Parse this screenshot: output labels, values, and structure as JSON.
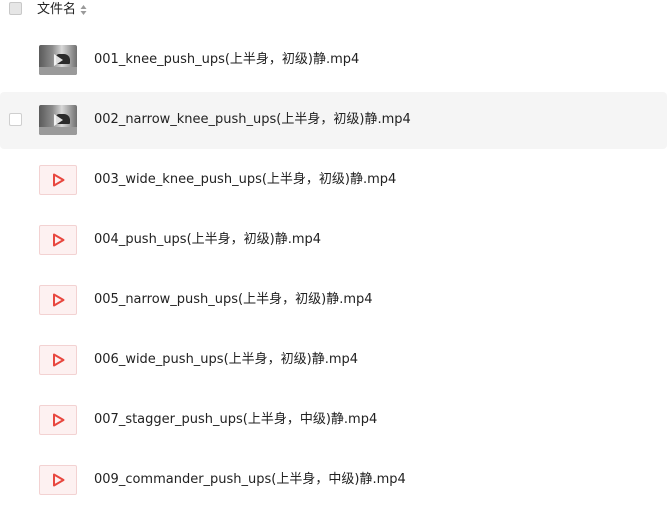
{
  "header": {
    "column_label": "文件名",
    "sort_icon": "sort-icon"
  },
  "files": [
    {
      "name": "001_knee_push_ups(上半身，初级)静.mp4",
      "thumb": "video-thumbnail"
    },
    {
      "name": "002_narrow_knee_push_ups(上半身，初级)静.mp4",
      "thumb": "video-thumbnail"
    },
    {
      "name": "003_wide_knee_push_ups(上半身，初级)静.mp4",
      "thumb": "video-file-icon"
    },
    {
      "name": "004_push_ups(上半身，初级)静.mp4",
      "thumb": "video-file-icon"
    },
    {
      "name": "005_narrow_push_ups(上半身，初级)静.mp4",
      "thumb": "video-file-icon"
    },
    {
      "name": "006_wide_push_ups(上半身，初级)静.mp4",
      "thumb": "video-file-icon"
    },
    {
      "name": "007_stagger_push_ups(上半身，中级)静.mp4",
      "thumb": "video-file-icon"
    },
    {
      "name": "009_commander_push_ups(上半身，中级)静.mp4",
      "thumb": "video-file-icon"
    }
  ],
  "colors": {
    "hover_row": "#f5f5f5",
    "file_icon_red": "#e8473f"
  }
}
